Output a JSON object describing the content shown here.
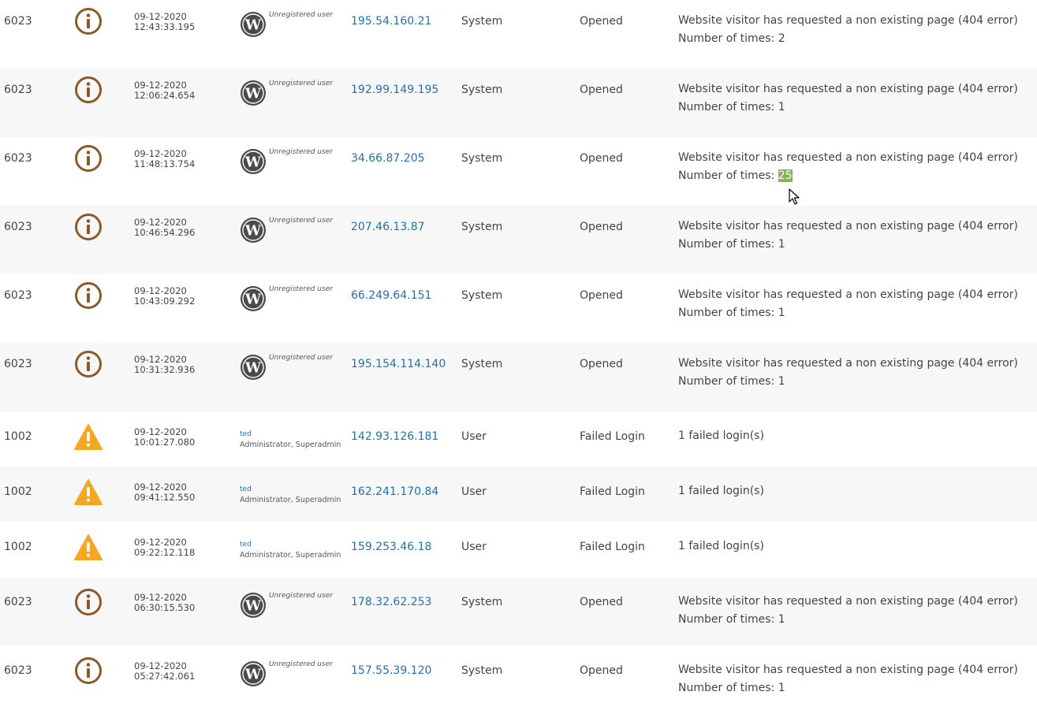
{
  "colors": {
    "info_icon": "#8b5a2b",
    "warning_icon": "#f5a623",
    "ip_link": "#2271b1",
    "row_alt_bg": "#f7f7f7",
    "highlight": "#8bb05a"
  },
  "icons": {
    "info": "info-circle-icon",
    "warning": "warning-triangle-icon",
    "wordpress": "wordpress-logo-icon",
    "cursor": "mouse-cursor-icon"
  },
  "rows": [
    {
      "code": "6023",
      "severity": "info",
      "date": "09-12-2020",
      "time": "12:43:33.195",
      "user_label": "Unregistered user",
      "ip": "195.54.160.21",
      "object": "System",
      "event_type": "Opened",
      "message": "Website visitor has requested a non existing page (404 error)",
      "times_label": "Number of times:",
      "times_value": "2"
    },
    {
      "code": "6023",
      "severity": "info",
      "date": "09-12-2020",
      "time": "12:06:24.654",
      "user_label": "Unregistered user",
      "ip": "192.99.149.195",
      "object": "System",
      "event_type": "Opened",
      "message": "Website visitor has requested a non existing page (404 error)",
      "times_label": "Number of times:",
      "times_value": "1"
    },
    {
      "code": "6023",
      "severity": "info",
      "date": "09-12-2020",
      "time": "11:48:13.754",
      "user_label": "Unregistered user",
      "ip": "34.66.87.205",
      "object": "System",
      "event_type": "Opened",
      "message": "Website visitor has requested a non existing page (404 error)",
      "times_label": "Number of times:",
      "times_value": "25"
    },
    {
      "code": "6023",
      "severity": "info",
      "date": "09-12-2020",
      "time": "10:46:54.296",
      "user_label": "Unregistered user",
      "ip": "207.46.13.87",
      "object": "System",
      "event_type": "Opened",
      "message": "Website visitor has requested a non existing page (404 error)",
      "times_label": "Number of times:",
      "times_value": "1"
    },
    {
      "code": "6023",
      "severity": "info",
      "date": "09-12-2020",
      "time": "10:43:09.292",
      "user_label": "Unregistered user",
      "ip": "66.249.64.151",
      "object": "System",
      "event_type": "Opened",
      "message": "Website visitor has requested a non existing page (404 error)",
      "times_label": "Number of times:",
      "times_value": "1"
    },
    {
      "code": "6023",
      "severity": "info",
      "date": "09-12-2020",
      "time": "10:31:32.936",
      "user_label": "Unregistered user",
      "ip": "195.154.114.140",
      "object": "System",
      "event_type": "Opened",
      "message": "Website visitor has requested a non existing page (404 error)",
      "times_label": "Number of times:",
      "times_value": "1"
    },
    {
      "code": "1002",
      "severity": "warning",
      "date": "09-12-2020",
      "time": "10:01:27.080",
      "username": "ted",
      "user_roles": "Administrator, Superadmin",
      "ip": "142.93.126.181",
      "object": "User",
      "event_type": "Failed Login",
      "message": "1 failed login(s)"
    },
    {
      "code": "1002",
      "severity": "warning",
      "date": "09-12-2020",
      "time": "09:41:12.550",
      "username": "ted",
      "user_roles": "Administrator, Superadmin",
      "ip": "162.241.170.84",
      "object": "User",
      "event_type": "Failed Login",
      "message": "1 failed login(s)"
    },
    {
      "code": "1002",
      "severity": "warning",
      "date": "09-12-2020",
      "time": "09:22:12.118",
      "username": "ted",
      "user_roles": "Administrator, Superadmin",
      "ip": "159.253.46.18",
      "object": "User",
      "event_type": "Failed Login",
      "message": "1 failed login(s)"
    },
    {
      "code": "6023",
      "severity": "info",
      "date": "09-12-2020",
      "time": "06:30:15.530",
      "user_label": "Unregistered user",
      "ip": "178.32.62.253",
      "object": "System",
      "event_type": "Opened",
      "message": "Website visitor has requested a non existing page (404 error)",
      "times_label": "Number of times:",
      "times_value": "1"
    },
    {
      "code": "6023",
      "severity": "info",
      "date": "09-12-2020",
      "time": "05:27:42.061",
      "user_label": "Unregistered user",
      "ip": "157.55.39.120",
      "object": "System",
      "event_type": "Opened",
      "message": "Website visitor has requested a non existing page (404 error)",
      "times_label": "Number of times:",
      "times_value": "1"
    }
  ]
}
